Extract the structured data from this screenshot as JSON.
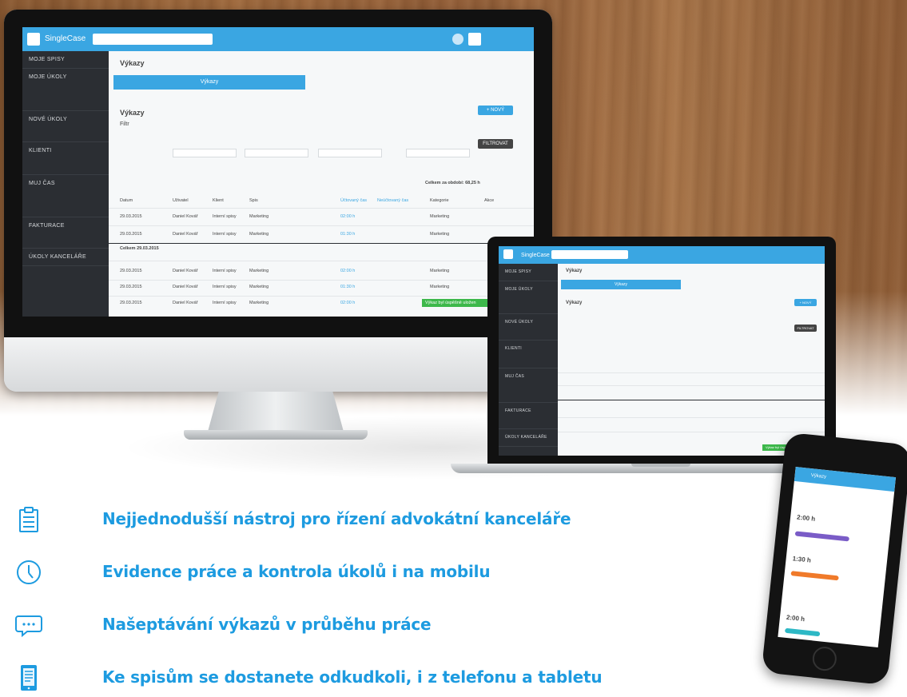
{
  "features": [
    {
      "icon": "clipboard-list-icon",
      "text": "Nejjednodušší nástroj pro řízení advokátní kanceláře"
    },
    {
      "icon": "clock-icon",
      "text": "Evidence práce a kontrola úkolů i na mobilu"
    },
    {
      "icon": "chat-bubble-icon",
      "text": "Našeptávání výkazů v průběhu práce"
    },
    {
      "icon": "mobile-document-icon",
      "text": "Ke spisům se dostanete odkudkoli, i z telefonu a tabletu"
    }
  ],
  "colors": {
    "accent": "#1d9be0",
    "app_blue": "#3aa6e2",
    "sidebar": "#2b2e33",
    "success": "#3db84b"
  },
  "imac_app": {
    "logo": "SingleCase",
    "sidebar": [
      "MOJE SPISY",
      "MOJE ÚKOLY",
      "NOVÉ ÚKOLY",
      "KLIENTI",
      "MUJ ČAS",
      "FAKTURACE",
      "ÚKOLY KANCELÁŘE"
    ],
    "page_title": "Výkazy",
    "tab_active": "Výkazy",
    "section_title": "Výkazy",
    "filter_label": "Filtr",
    "filter_button": "FILTROVAT",
    "add_button": "+ NOVÝ",
    "total_label": "Celkem za období: 68,25 h",
    "table_headers": [
      "Datum",
      "Uživatel",
      "Klient",
      "Spis",
      "Účtovaný čas",
      "Neúčtovaný čas",
      "Kategorie",
      "Akce"
    ],
    "rows": [
      {
        "date": "29.03.2015",
        "user": "Daniel Kovář",
        "client": "Interní spisy",
        "matter": "Marketing",
        "time": "02:00 h",
        "category": "Marketing"
      },
      {
        "date": "29.03.2015",
        "user": "Daniel Kovář",
        "client": "Interní spisy",
        "matter": "Marketing",
        "time": "01:30 h",
        "category": "Marketing"
      },
      {
        "date": "29.03.2015",
        "user": "Daniel Kovář",
        "client": "Interní spisy",
        "matter": "Marketing",
        "time": "02:00 h",
        "category": "Marketing"
      },
      {
        "date": "29.03.2015",
        "user": "Daniel Kovář",
        "client": "Interní spisy",
        "matter": "Marketing",
        "time": "01:30 h",
        "category": "Marketing"
      },
      {
        "date": "29.03.2015",
        "user": "Daniel Kovář",
        "client": "Interní spisy",
        "matter": "Marketing",
        "time": "02:00 h",
        "category": "Marketing"
      }
    ],
    "day_total": "Celkem 29.03.2015",
    "success_banner": "Výkaz byl úspěšně uložen"
  },
  "phone_app": {
    "title": "Výkazy",
    "entries": [
      "2:00 h",
      "1:30 h",
      "2:00 h"
    ]
  }
}
